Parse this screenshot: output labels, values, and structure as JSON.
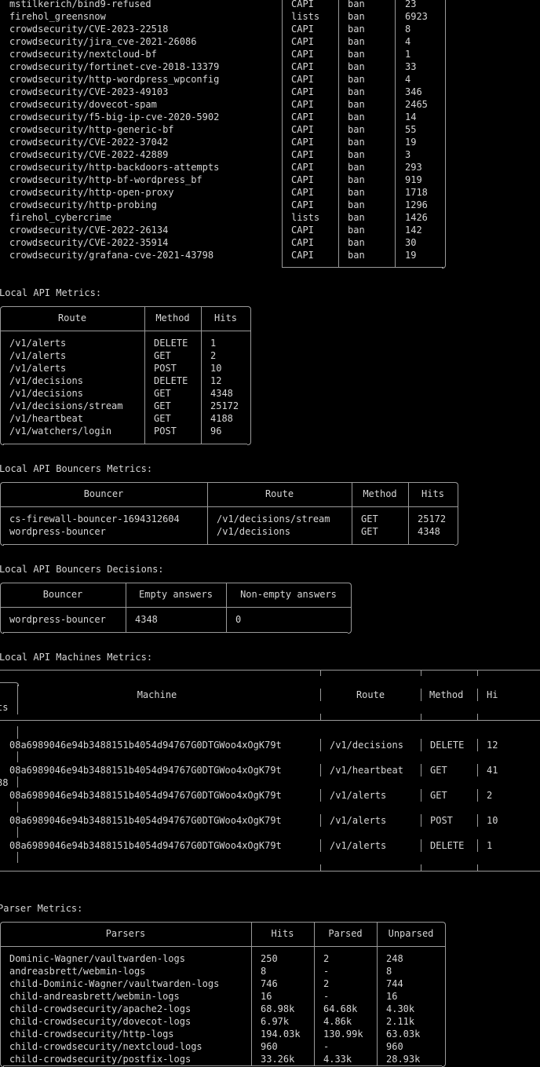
{
  "decisions_table": {
    "rows": [
      [
        "mstilkerich/bind9-refused",
        "CAPI",
        "ban",
        "23"
      ],
      [
        "firehol_greensnow",
        "lists",
        "ban",
        "6923"
      ],
      [
        "crowdsecurity/CVE-2023-22518",
        "CAPI",
        "ban",
        "8"
      ],
      [
        "crowdsecurity/jira_cve-2021-26086",
        "CAPI",
        "ban",
        "4"
      ],
      [
        "crowdsecurity/nextcloud-bf",
        "CAPI",
        "ban",
        "1"
      ],
      [
        "crowdsecurity/fortinet-cve-2018-13379",
        "CAPI",
        "ban",
        "33"
      ],
      [
        "crowdsecurity/http-wordpress_wpconfig",
        "CAPI",
        "ban",
        "4"
      ],
      [
        "crowdsecurity/CVE-2023-49103",
        "CAPI",
        "ban",
        "346"
      ],
      [
        "crowdsecurity/dovecot-spam",
        "CAPI",
        "ban",
        "2465"
      ],
      [
        "crowdsecurity/f5-big-ip-cve-2020-5902",
        "CAPI",
        "ban",
        "14"
      ],
      [
        "crowdsecurity/http-generic-bf",
        "CAPI",
        "ban",
        "55"
      ],
      [
        "crowdsecurity/CVE-2022-37042",
        "CAPI",
        "ban",
        "19"
      ],
      [
        "crowdsecurity/CVE-2022-42889",
        "CAPI",
        "ban",
        "3"
      ],
      [
        "crowdsecurity/http-backdoors-attempts",
        "CAPI",
        "ban",
        "293"
      ],
      [
        "crowdsecurity/http-bf-wordpress_bf",
        "CAPI",
        "ban",
        "919"
      ],
      [
        "crowdsecurity/http-open-proxy",
        "CAPI",
        "ban",
        "1718"
      ],
      [
        "crowdsecurity/http-probing",
        "CAPI",
        "ban",
        "1296"
      ],
      [
        "firehol_cybercrime",
        "lists",
        "ban",
        "1426"
      ],
      [
        "crowdsecurity/CVE-2022-26134",
        "CAPI",
        "ban",
        "142"
      ],
      [
        "crowdsecurity/CVE-2022-35914",
        "CAPI",
        "ban",
        "30"
      ],
      [
        "crowdsecurity/grafana-cve-2021-43798",
        "CAPI",
        "ban",
        "19"
      ]
    ]
  },
  "lapi": {
    "title": "Local API Metrics:",
    "headers": [
      "Route",
      "Method",
      "Hits"
    ],
    "rows": [
      [
        "/v1/alerts",
        "DELETE",
        "1"
      ],
      [
        "/v1/alerts",
        "GET",
        "2"
      ],
      [
        "/v1/alerts",
        "POST",
        "10"
      ],
      [
        "/v1/decisions",
        "DELETE",
        "12"
      ],
      [
        "/v1/decisions",
        "GET",
        "4348"
      ],
      [
        "/v1/decisions/stream",
        "GET",
        "25172"
      ],
      [
        "/v1/heartbeat",
        "GET",
        "4188"
      ],
      [
        "/v1/watchers/login",
        "POST",
        "96"
      ]
    ]
  },
  "bouncers": {
    "title": "Local API Bouncers Metrics:",
    "headers": [
      "Bouncer",
      "Route",
      "Method",
      "Hits"
    ],
    "rows": [
      [
        "cs-firewall-bouncer-1694312604",
        "/v1/decisions/stream",
        "GET",
        "25172"
      ],
      [
        "wordpress-bouncer",
        "/v1/decisions",
        "GET",
        "4348"
      ]
    ]
  },
  "bouncer_decisions": {
    "title": "Local API Bouncers Decisions:",
    "headers": [
      "Bouncer",
      "Empty answers",
      "Non-empty answers"
    ],
    "rows": [
      [
        "wordpress-bouncer",
        "4348",
        "0"
      ]
    ]
  },
  "machines": {
    "title": "Local API Machines Metrics:",
    "headers": [
      "Machine",
      "Route",
      "Method",
      "Hi"
    ],
    "header_wrap": "ts",
    "wrap_fragment": "88",
    "rows": [
      [
        "08a6989046e94b3488151b4054d94767G0DTGWoo4xOgK79t",
        "/v1/decisions",
        "DELETE",
        "12"
      ],
      [
        "08a6989046e94b3488151b4054d94767G0DTGWoo4xOgK79t",
        "/v1/heartbeat",
        "GET",
        "41"
      ],
      [
        "08a6989046e94b3488151b4054d94767G0DTGWoo4xOgK79t",
        "/v1/alerts",
        "GET",
        "2"
      ],
      [
        "08a6989046e94b3488151b4054d94767G0DTGWoo4xOgK79t",
        "/v1/alerts",
        "POST",
        "10"
      ],
      [
        "08a6989046e94b3488151b4054d94767G0DTGWoo4xOgK79t",
        "/v1/alerts",
        "DELETE",
        "1"
      ]
    ]
  },
  "parsers": {
    "title": "Parser Metrics:",
    "headers": [
      "Parsers",
      "Hits",
      "Parsed",
      "Unparsed"
    ],
    "rows": [
      [
        "Dominic-Wagner/vaultwarden-logs",
        "250",
        "2",
        "248"
      ],
      [
        "andreasbrett/webmin-logs",
        "8",
        "-",
        "8"
      ],
      [
        "child-Dominic-Wagner/vaultwarden-logs",
        "746",
        "2",
        "744"
      ],
      [
        "child-andreasbrett/webmin-logs",
        "16",
        "-",
        "16"
      ],
      [
        "child-crowdsecurity/apache2-logs",
        "68.98k",
        "64.68k",
        "4.30k"
      ],
      [
        "child-crowdsecurity/dovecot-logs",
        "6.97k",
        "4.86k",
        "2.11k"
      ],
      [
        "child-crowdsecurity/http-logs",
        "194.03k",
        "130.99k",
        "63.03k"
      ],
      [
        "child-crowdsecurity/nextcloud-logs",
        "960",
        "-",
        "960"
      ],
      [
        "child-crowdsecurity/postfix-logs",
        "33.26k",
        "4.33k",
        "28.93k"
      ]
    ]
  }
}
